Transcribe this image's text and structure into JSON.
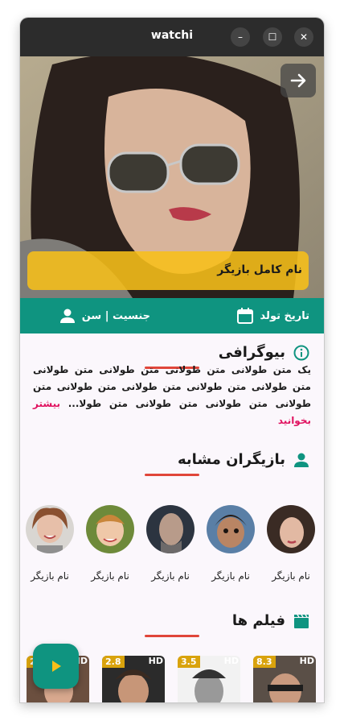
{
  "window": {
    "title": "watchi",
    "minimize": "–",
    "maximize": "☐",
    "close": "✕"
  },
  "hero": {
    "actor_full_name": "نام کامل بازیگر"
  },
  "info": {
    "birth_date": "تاریخ تولد",
    "gender_age": "جنسیت | سن"
  },
  "bio": {
    "heading": "بیوگرافی",
    "text": "یک متن طولانی متن طولانی متن طولانی متن طولانی متن طولانی متن طولانی متن طولانی متن طولانی متن طولانی متن طولانی متن طولانی متن طولا...",
    "read_more": "بیشتر بخوانید"
  },
  "similar": {
    "heading": "بازیگران مشابه",
    "actors": [
      {
        "name": "نام بازیگر"
      },
      {
        "name": "نام بازیگر"
      },
      {
        "name": "نام بازیگر"
      },
      {
        "name": "نام بازیگر"
      },
      {
        "name": "نام بازیگر"
      }
    ]
  },
  "films": {
    "heading": "فیلم ها",
    "items": [
      {
        "rating": "8.3",
        "quality": "HD"
      },
      {
        "rating": "3.5",
        "quality": "HD"
      },
      {
        "rating": "2.8",
        "quality": "HD"
      },
      {
        "rating": "2",
        "quality": "HD"
      }
    ]
  },
  "colors": {
    "primary": "#0f9480",
    "accent_yellow": "#f7bf19",
    "underline": "#e0463a",
    "link": "#e0115f"
  }
}
